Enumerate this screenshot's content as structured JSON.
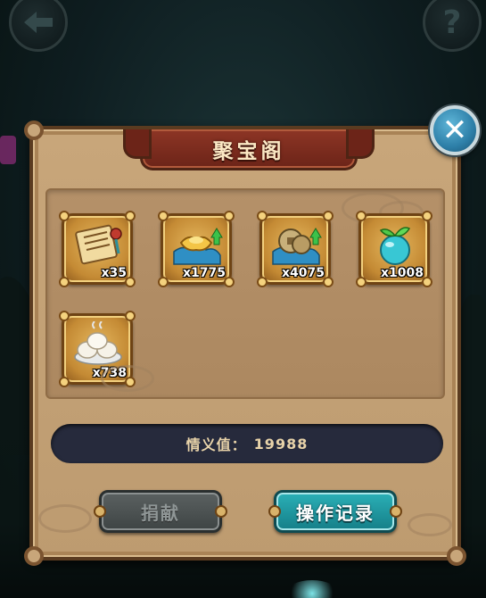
{
  "nav": {
    "back_icon": "arrow-left-icon",
    "help_label": "?"
  },
  "dialog": {
    "title": "聚宝阁",
    "close_label": "✕",
    "items": [
      {
        "name": "scroll-item",
        "icon": "scroll-icon",
        "count": "x35"
      },
      {
        "name": "gold-ingot-item",
        "icon": "gold-ingot-upgrade-icon",
        "count": "x1775"
      },
      {
        "name": "copper-coin-item",
        "icon": "copper-coin-upgrade-icon",
        "count": "x4075"
      },
      {
        "name": "sprout-orb-item",
        "icon": "sprout-orb-icon",
        "count": "x1008"
      },
      {
        "name": "steamed-bun-item",
        "icon": "steamed-buns-icon",
        "count": "x738"
      }
    ],
    "value_label": "情义值：",
    "value_number": "19988",
    "donate_button": "捐献",
    "records_button": "操作记录"
  },
  "colors": {
    "panel": "#c8a67a",
    "banner": "#8d3525",
    "records_button": "#2bb0b7",
    "donate_button": "#5b6161",
    "value_bar": "#262a3c"
  }
}
